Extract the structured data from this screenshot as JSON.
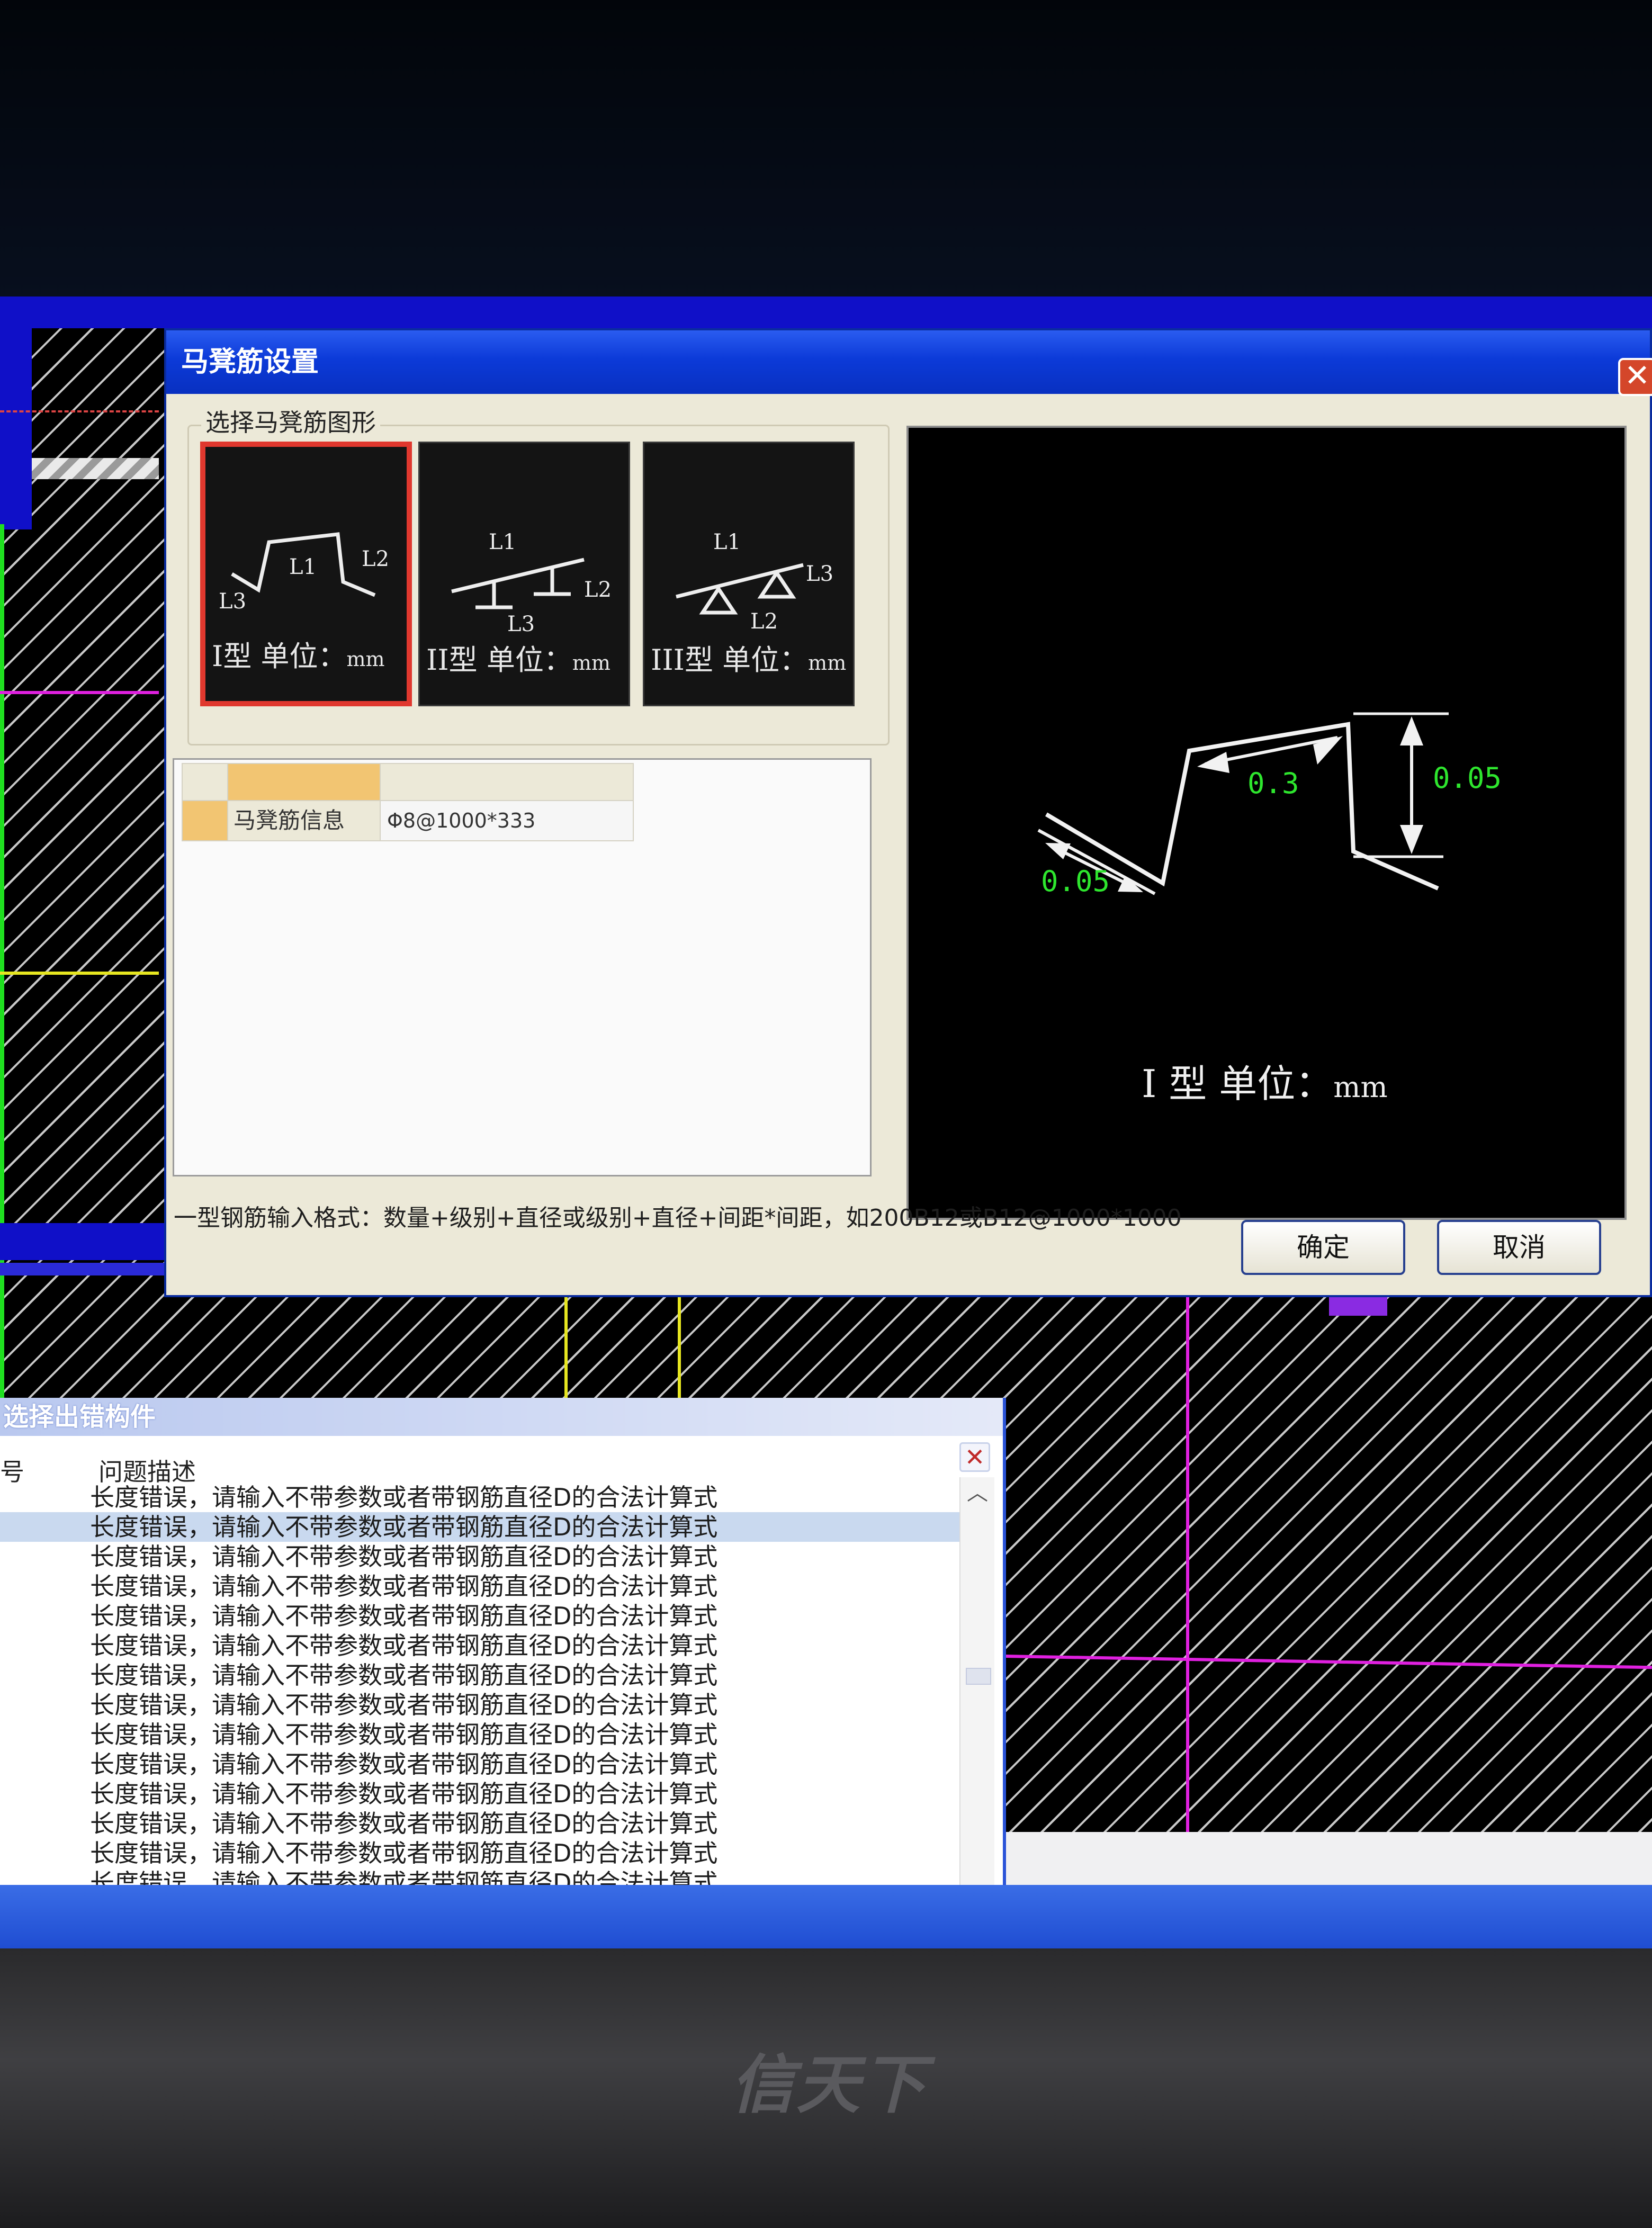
{
  "dialog": {
    "title": "马凳筋设置",
    "close_glyph": "✕",
    "group_title": "选择马凳筋图形",
    "shapes": [
      {
        "type": "I型",
        "unit_label": "单位：",
        "unit": "mm",
        "labels": [
          "L1",
          "L2",
          "L3"
        ],
        "selected": true
      },
      {
        "type": "II型",
        "unit_label": "单位：",
        "unit": "mm",
        "labels": [
          "L1",
          "L2",
          "L3"
        ],
        "selected": false
      },
      {
        "type": "III型",
        "unit_label": "单位：",
        "unit": "mm",
        "labels": [
          "L1",
          "L2",
          "L3"
        ],
        "selected": false
      }
    ],
    "grid": {
      "row_label": "马凳筋信息",
      "row_value": "Φ8@1000*333"
    },
    "preview": {
      "dim_top": "0.3",
      "dim_right": "0.05",
      "dim_left": "0.05",
      "caption_type": "I 型",
      "caption_unit_label": "单位：",
      "caption_unit": "mm",
      "dim_color": "#2ee62e",
      "line_color": "#f2f2f2"
    },
    "hint": "一型钢筋输入格式：数量+级别+直径或级别+直径+间距*间距，如200B12或B12@1000*1000",
    "ok_label": "确定",
    "cancel_label": "取消"
  },
  "error_window": {
    "title": "选择出错构件",
    "column_left": "号",
    "column_desc": "问题描述",
    "close_glyph": "✕",
    "rows": [
      "长度错误，请输入不带参数或者带钢筋直径D的合法计算式",
      "长度错误，请输入不带参数或者带钢筋直径D的合法计算式",
      "长度错误，请输入不带参数或者带钢筋直径D的合法计算式",
      "长度错误，请输入不带参数或者带钢筋直径D的合法计算式",
      "长度错误，请输入不带参数或者带钢筋直径D的合法计算式",
      "长度错误，请输入不带参数或者带钢筋直径D的合法计算式",
      "长度错误，请输入不带参数或者带钢筋直径D的合法计算式",
      "长度错误，请输入不带参数或者带钢筋直径D的合法计算式",
      "长度错误，请输入不带参数或者带钢筋直径D的合法计算式",
      "长度错误，请输入不带参数或者带钢筋直径D的合法计算式",
      "长度错误，请输入不带参数或者带钢筋直径D的合法计算式",
      "长度错误，请输入不带参数或者带钢筋直径D的合法计算式",
      "长度错误，请输入不带参数或者带钢筋直径D的合法计算式",
      "长度错误，请输入不带参数或者带钢筋直径D的合法计算式"
    ],
    "highlight_row": 1,
    "scroll_up_glyph": "︿",
    "scroll_down_glyph": "﹀"
  },
  "monitor": {
    "brand": "信天下"
  },
  "colors": {
    "cad_blue": "#1010c8",
    "magenta": "#e020e0",
    "yellow": "#e6e620",
    "green": "#20e020",
    "selected_border": "#e0382e"
  }
}
